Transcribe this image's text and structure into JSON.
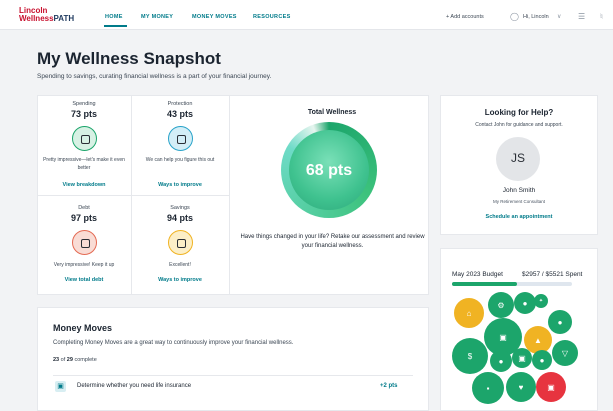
{
  "nav": {
    "logo_top": "Lincoln",
    "logo_bottom_a": "Wellness",
    "logo_bottom_b": "PATH",
    "tabs": [
      {
        "label": "HOME"
      },
      {
        "label": "MY MONEY"
      },
      {
        "label": "MONEY MOVES"
      },
      {
        "label": "RESOURCES"
      }
    ],
    "add_accounts": "+ Add accounts",
    "greeting": "Hi, Lincoln",
    "icons": [
      "user-icon",
      "chevron-down-icon",
      "bars-icon",
      "bell-icon"
    ]
  },
  "header": {
    "title": "My Wellness Snapshot",
    "subtitle": "Spending to savings, curating financial wellness is a part of your financial journey."
  },
  "metrics": [
    {
      "label": "Spending",
      "pts": "73 pts",
      "desc": "Pretty impressive—let's make it even better",
      "link": "View breakdown",
      "color": "#1ca56b",
      "icon": "hand-icon"
    },
    {
      "label": "Protection",
      "pts": "43 pts",
      "desc": "We can help you figure this out",
      "link": "Ways to improve",
      "color": "#29a3c9",
      "icon": "shield-icon"
    },
    {
      "label": "Debt",
      "pts": "97 pts",
      "desc": "Very impressive! Keep it up",
      "link": "View total debt",
      "color": "#e46a53",
      "icon": "card-icon"
    },
    {
      "label": "Savings",
      "pts": "94 pts",
      "desc": "Excellent!",
      "link": "Ways to improve",
      "color": "#f0b323",
      "icon": "piggy-bank-icon"
    }
  ],
  "total_wellness": {
    "title": "Total Wellness",
    "score": "68 pts",
    "text": "Have things changed in your life? Retake our assessment and review your financial wellness."
  },
  "help": {
    "title": "Looking for Help?",
    "subtitle": "Contact John for guidance and support.",
    "initials": "JS",
    "name": "John Smith",
    "role": "My Retirement Consultant",
    "link": "Schedule an appointment"
  },
  "budget": {
    "title": "May 2023 Budget",
    "spent": "$2957 / $5521 Spent",
    "progress": 0.54,
    "accent": "#1ca56b"
  },
  "money_moves": {
    "title": "Money Moves",
    "subtitle": "Completing Money Moves are a great way to continuously improve your financial wellness.",
    "done": "23",
    "of_label": "of",
    "total": "29",
    "complete_label": "complete",
    "row_text": "Determine whether you need life insurance",
    "row_pts": "+2 pts"
  }
}
